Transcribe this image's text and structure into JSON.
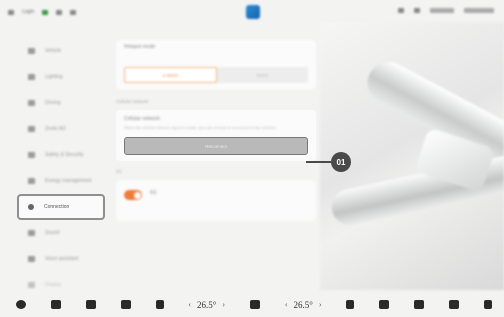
{
  "status_bar": {
    "left_items": [
      "Login",
      "",
      "",
      ""
    ],
    "right_items": [
      "",
      "",
      "",
      ""
    ]
  },
  "sidebar": {
    "items": [
      {
        "label": "Vehicle",
        "icon": "car-icon",
        "active": false
      },
      {
        "label": "Lighting",
        "icon": "light-icon",
        "active": false
      },
      {
        "label": "Driving",
        "icon": "steering-icon",
        "active": false
      },
      {
        "label": "Zeekr AD",
        "icon": "assist-icon",
        "active": false
      },
      {
        "label": "Safety & Security",
        "icon": "shield-icon",
        "active": false
      },
      {
        "label": "Energy management",
        "icon": "battery-icon",
        "active": false
      },
      {
        "label": "Connection",
        "icon": "link-icon",
        "active": true
      },
      {
        "label": "Sound",
        "icon": "sound-icon",
        "active": false
      },
      {
        "label": "Voice assistant",
        "icon": "mic-icon",
        "active": false
      },
      {
        "label": "Display",
        "icon": "display-icon",
        "active": false
      }
    ]
  },
  "hotspot": {
    "title": "Hotspot mode",
    "description": "",
    "options": [
      "2.4GHz",
      "5GHz"
    ],
    "selected": "2.4GHz"
  },
  "cellular": {
    "section_label": "Cellular network",
    "title": "Cellular network",
    "description": "When the cellular network signal is weak, you can choose to reconnect to the network",
    "button_label": "Reconnect"
  },
  "fiveg": {
    "section_label": "5G",
    "title": "5G",
    "description": "",
    "enabled": true
  },
  "callout": {
    "number": "01"
  },
  "dock": {
    "left_temp": "26.5°",
    "right_temp": "26.5°"
  },
  "colors": {
    "accent_orange": "#f07a3a",
    "highlight_border": "#8f8f8f",
    "callout": "#4a4a4a"
  }
}
